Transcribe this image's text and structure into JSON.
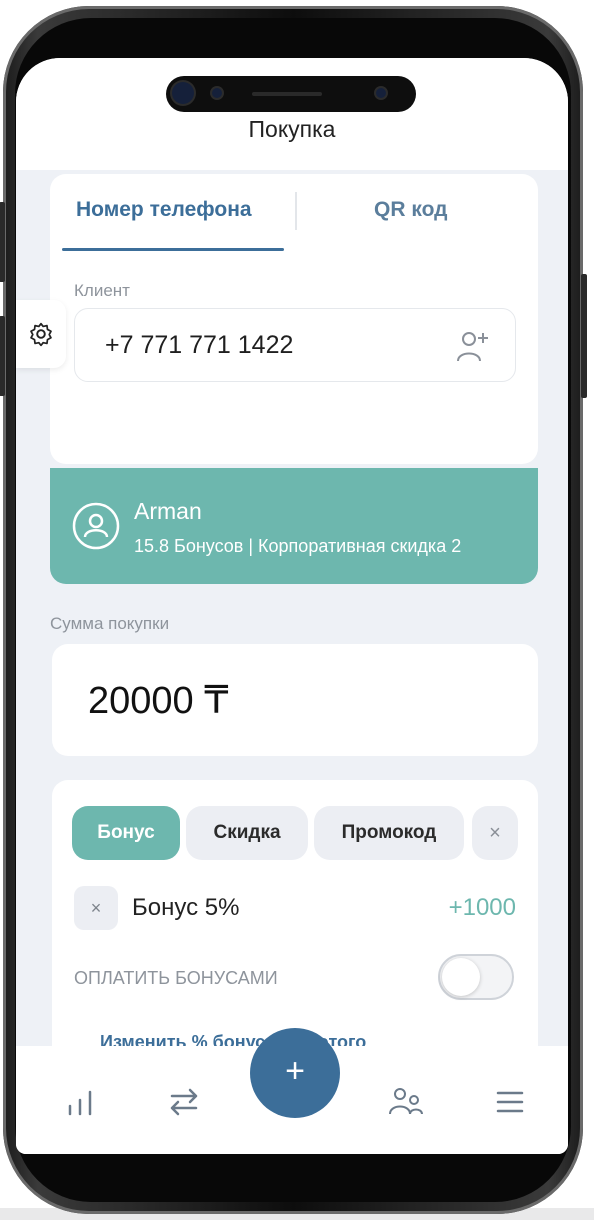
{
  "app": {
    "title": "Покупка"
  },
  "tabs": [
    {
      "label": "Номер телефона",
      "active": true
    },
    {
      "label": "QR код",
      "active": false
    }
  ],
  "client_section": {
    "label": "Клиент",
    "phone_value": "+7 771 771 1422"
  },
  "client_card": {
    "name": "Arman",
    "info": "15.8 Бонусов | Корпоративная скидка 2"
  },
  "purchase": {
    "label": "Сумма покупки",
    "amount": "20000 ₸"
  },
  "modes": {
    "bonus_label": "Бонус",
    "discount_label": "Скидка",
    "promo_label": "Промокод",
    "close_symbol": "×",
    "selected": "Бонус"
  },
  "bonus_line": {
    "remove_symbol": "×",
    "label": "Бонус 5%",
    "amount": "+1000"
  },
  "pay_with_bonuses": {
    "label": "ОПЛАТИТЬ БОНУСАМИ",
    "enabled": false
  },
  "change_bonus_link": "Изменить % бонуса для этого клиента",
  "nav": {
    "fab_symbol": "+",
    "items": [
      "chart-icon",
      "transfer-icon",
      "add-icon",
      "users-icon",
      "menu-icon"
    ]
  },
  "colors": {
    "primary": "#3c6e99",
    "accent_teal": "#6db7ae",
    "background": "#eef1f6"
  }
}
